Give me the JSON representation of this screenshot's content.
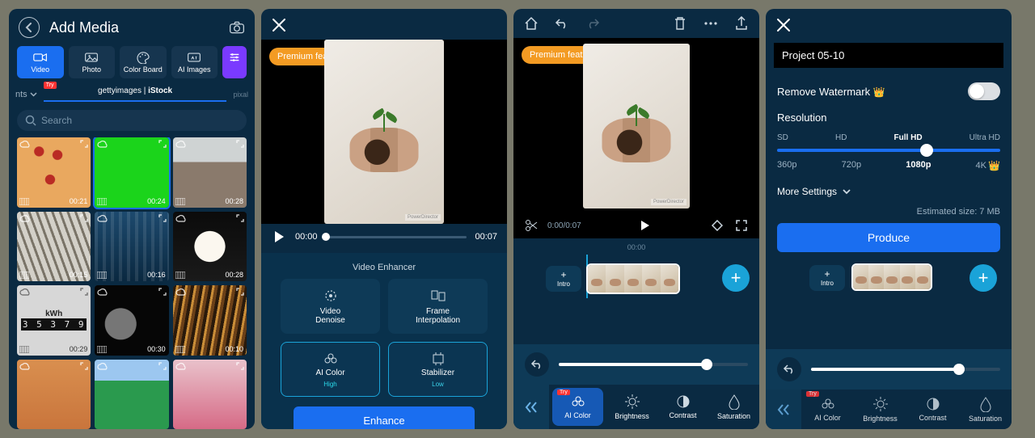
{
  "screen1": {
    "title": "Add Media",
    "tabs": [
      {
        "label": "Video"
      },
      {
        "label": "Photo"
      },
      {
        "label": "Color Board"
      },
      {
        "label": "AI Images"
      }
    ],
    "nts": "nts",
    "try": "Try",
    "getty": "gettyimages",
    "istock": "iStock",
    "pixo": "pixal",
    "search_ph": "Search",
    "thumbs": [
      {
        "dur": "00:21"
      },
      {
        "dur": "00:24"
      },
      {
        "dur": "00:28"
      },
      {
        "dur": "00:15"
      },
      {
        "dur": "00:16"
      },
      {
        "dur": "00:28"
      },
      {
        "dur": "00:29",
        "kwh": "kWh",
        "digits": "3 5 3 7 9"
      },
      {
        "dur": "00:30"
      },
      {
        "dur": "00:10"
      },
      {
        "dur": ""
      },
      {
        "dur": ""
      },
      {
        "dur": ""
      }
    ]
  },
  "screen2": {
    "premium": "Premium features used",
    "t_cur": "00:00",
    "t_tot": "00:07",
    "wm": "PowerDirector",
    "section": "Video Enhancer",
    "opts": [
      {
        "label": "Video\nDenoise"
      },
      {
        "label": "Frame\nInterpolation"
      },
      {
        "label": "AI Color",
        "sub": "High"
      },
      {
        "label": "Stabilizer",
        "sub": "Low"
      }
    ],
    "enhance": "Enhance"
  },
  "screen3": {
    "premium": "Premium features used",
    "time": "0:00/0:07",
    "ruler": "00:00",
    "intro": "Intro",
    "wm": "PowerDirector",
    "slider_pct": 78,
    "tools": [
      {
        "label": "AI Color",
        "try": "Try"
      },
      {
        "label": "Brightness"
      },
      {
        "label": "Contrast"
      },
      {
        "label": "Saturation"
      }
    ]
  },
  "screen4": {
    "project": "Project 05-10",
    "watermark": "Remove Watermark",
    "resolution": "Resolution",
    "res_lbls": [
      "SD",
      "HD",
      "Full HD",
      "Ultra HD"
    ],
    "res_vals": [
      "360p",
      "720p",
      "1080p",
      "4K"
    ],
    "more": "More Settings",
    "est": "Estimated size: 7 MB",
    "produce": "Produce",
    "intro": "Intro",
    "slider_pct": 78,
    "tools": [
      {
        "label": "AI Color",
        "try": "Try"
      },
      {
        "label": "Brightness"
      },
      {
        "label": "Contrast"
      },
      {
        "label": "Saturation"
      }
    ]
  }
}
